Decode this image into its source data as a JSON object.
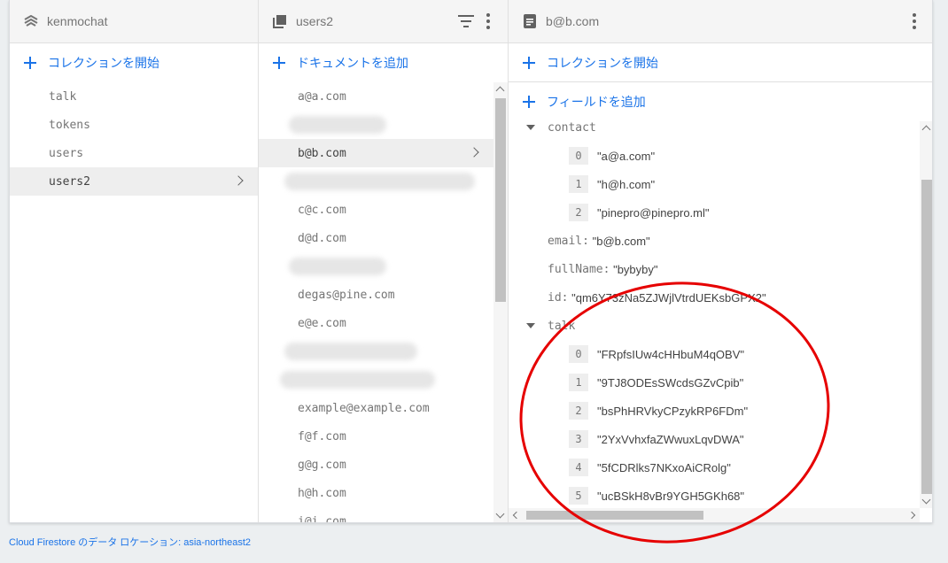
{
  "columns": {
    "root": {
      "title": "kenmochat",
      "add_label": "コレクションを開始",
      "items": [
        "talk",
        "tokens",
        "users",
        "users2"
      ],
      "selected": "users2"
    },
    "collection": {
      "title": "users2",
      "add_label": "ドキュメントを追加",
      "items": [
        "a@a.com",
        "",
        "b@b.com",
        "",
        "c@c.com",
        "d@d.com",
        "",
        "degas@pine.com",
        "e@e.com",
        "",
        "",
        "example@example.com",
        "f@f.com",
        "g@g.com",
        "h@h.com",
        "i@i.com"
      ],
      "selected": "b@b.com"
    },
    "document": {
      "title": "b@b.com",
      "add_collection_label": "コレクションを開始",
      "add_field_label": "フィールドを追加",
      "contact_key": "contact",
      "contact": [
        {
          "index": "0",
          "value": "\"a@a.com\""
        },
        {
          "index": "1",
          "value": "\"h@h.com\""
        },
        {
          "index": "2",
          "value": "\"pinepro@pinepro.ml\""
        }
      ],
      "email_key": "email:",
      "email_value": "\"b@b.com\"",
      "fullname_key": "fullName:",
      "fullname_value": "\"bybyby\"",
      "id_key": "id:",
      "id_value": "\"qm6Y73zNa5ZJWjlVtrdUEKsbGPX2\"",
      "talk_key": "talk",
      "talk": [
        {
          "index": "0",
          "value": "\"FRpfsIUw4cHHbuM4qOBV\""
        },
        {
          "index": "1",
          "value": "\"9TJ8ODEsSWcdsGZvCpib\""
        },
        {
          "index": "2",
          "value": "\"bsPhHRVkyCPzykRP6FDm\""
        },
        {
          "index": "3",
          "value": "\"2YxVvhxfaZWwuxLqvDWA\""
        },
        {
          "index": "4",
          "value": "\"5fCDRlks7NKxoAiCRolg\""
        },
        {
          "index": "5",
          "value": "\"ucBSkH8vBr9YGH5GKh68\""
        }
      ]
    }
  },
  "footer_text": "Cloud Firestore のデータ ロケーション: asia-northeast2",
  "colors": {
    "accent": "#1a73e8",
    "annotation": "#e60000"
  }
}
